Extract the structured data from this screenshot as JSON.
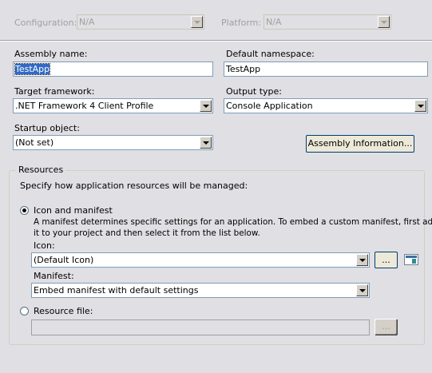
{
  "config_bar": {
    "configuration_label": "Configuration:",
    "configuration_value": "N/A",
    "platform_label": "Platform:",
    "platform_value": "N/A"
  },
  "assembly_name": {
    "label": "Assembly name:",
    "value": "TestApp"
  },
  "default_namespace": {
    "label": "Default namespace:",
    "value": "TestApp"
  },
  "target_framework": {
    "label": "Target framework:",
    "value": ".NET Framework 4 Client Profile"
  },
  "output_type": {
    "label": "Output type:",
    "value": "Console Application"
  },
  "startup_object": {
    "label": "Startup object:",
    "value": "(Not set)"
  },
  "assembly_info_button": "Assembly Information...",
  "resources": {
    "legend": "Resources",
    "description": "Specify how application resources will be managed:",
    "icon_and_manifest": {
      "label": "Icon and manifest",
      "selected": true,
      "desc_line1": "A manifest determines specific settings for an application. To embed a custom manifest, first add",
      "desc_line2": "it to your project and then select it from the list below.",
      "icon_label": "Icon:",
      "icon_value": "(Default Icon)",
      "browse_label": "...",
      "manifest_label": "Manifest:",
      "manifest_value": "Embed manifest with default settings"
    },
    "resource_file": {
      "label": "Resource file:",
      "selected": false,
      "value": "",
      "browse_label": "..."
    }
  }
}
